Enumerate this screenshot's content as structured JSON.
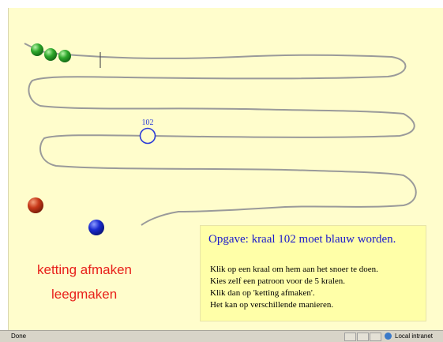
{
  "game": {
    "string_label": "102",
    "beads_on_string": [
      {
        "color": "#2ea82c"
      },
      {
        "color": "#2ea82c"
      },
      {
        "color": "#2ea82c"
      }
    ],
    "palette": [
      {
        "name": "red-bead",
        "color": "#c8391a"
      },
      {
        "name": "blue-bead",
        "color": "#1a2bd0"
      }
    ],
    "actions": {
      "finish": "ketting afmaken",
      "clear": "leegmaken"
    }
  },
  "task": {
    "title": "Opgave: kraal 102 moet blauw worden.",
    "lines": [
      "Klik op een kraal om hem aan het snoer te doen.",
      "Kies zelf een patroon voor de 5 kralen.",
      "Klik dan op 'ketting afmaken'.",
      "Het kan op verschillende manieren."
    ]
  },
  "statusbar": {
    "status": "Done",
    "zone": "Local intranet"
  },
  "colors": {
    "background": "#fffdcc",
    "task_box": "#ffffa8",
    "title_text": "#1a1acb",
    "action_text": "#e8211b",
    "string": "#9a9a9a"
  }
}
